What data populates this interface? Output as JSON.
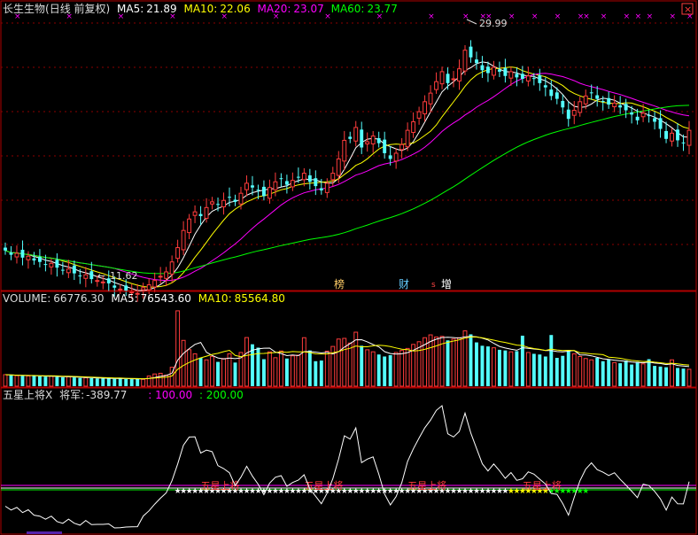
{
  "colors": {
    "bg": "#000000",
    "up": "#ff3c3c",
    "down": "#54ffff",
    "ma5": "#ffffff",
    "ma10": "#ffff00",
    "ma20": "#ff00ff",
    "ma60": "#00ff00",
    "grid": "#8b0000",
    "border": "#b00000",
    "label": "#dcdcdc",
    "general_line": "#ffffff",
    "level_100": "#ff00ff",
    "level_200": "#00ff00"
  },
  "header": {
    "stock": "长生生物",
    "period": "(日线 前复权)",
    "ma5_label": "MA5:",
    "ma5": "21.89",
    "ma10_label": "MA10:",
    "ma10": "22.06",
    "ma20_label": "MA20:",
    "ma20": "23.07",
    "ma60_label": "MA60:",
    "ma60": "23.77"
  },
  "volume_header": {
    "label": "VOLUME:",
    "value": "66776.30",
    "ma5_label": "MA5:",
    "ma5": "76543.60",
    "ma10_label": "MA10:",
    "ma10": "85564.80"
  },
  "indicator_header": {
    "name": "五星上将X",
    "general_label": "将军:",
    "general": "-389.77",
    "level1": ": 100.00",
    "level2": ": 200.00"
  },
  "annotations": {
    "high": "29.99",
    "low": "11.62",
    "marker_bang": "榜",
    "marker_cai": "财",
    "marker_zeng": "增",
    "marker_s": "s",
    "signal_text": "五星上将"
  },
  "chart_data": {
    "type": "candlestick",
    "price_axis": [
      12,
      32
    ],
    "close": [
      14.8,
      14.5,
      14.6,
      14.3,
      14.4,
      14.1,
      14.0,
      13.8,
      13.9,
      13.6,
      13.4,
      13.5,
      13.2,
      13.0,
      13.1,
      12.8,
      12.7,
      12.6,
      12.5,
      12.2,
      12.1,
      12.0,
      11.9,
      11.8,
      12.2,
      12.4,
      12.7,
      13.0,
      13.3,
      14.0,
      15.0,
      16.2,
      17.0,
      17.5,
      17.2,
      17.8,
      18.2,
      18.0,
      18.3,
      18.5,
      18.2,
      18.8,
      19.5,
      19.2,
      19.0,
      18.6,
      19.2,
      19.6,
      19.8,
      19.4,
      19.7,
      19.9,
      20.2,
      19.6,
      19.3,
      19.0,
      19.5,
      20.2,
      21.2,
      22.5,
      22.6,
      23.4,
      22.0,
      22.4,
      22.8,
      22.3,
      21.6,
      21.2,
      21.6,
      22.2,
      23.2,
      23.8,
      24.5,
      25.2,
      25.8,
      26.6,
      27.3,
      26.5,
      26.8,
      27.5,
      28.8,
      28.3,
      27.9,
      27.4,
      27.2,
      27.6,
      27.3,
      27.0,
      27.3,
      26.9,
      26.8,
      27.0,
      26.8,
      26.5,
      26.2,
      25.6,
      25.4,
      24.8,
      24.0,
      24.6,
      25.2,
      25.6,
      25.8,
      25.4,
      25.2,
      25.0,
      25.1,
      24.8,
      24.6,
      24.3,
      23.9,
      24.4,
      24.2,
      23.8,
      23.3,
      22.6,
      23.0,
      22.5,
      22.3,
      23.2
    ],
    "volume": [
      8600,
      8100,
      7900,
      7700,
      7600,
      7900,
      7300,
      7100,
      7500,
      6900,
      6600,
      7100,
      6500,
      6100,
      6300,
      6000,
      5700,
      5800,
      5600,
      5500,
      5900,
      5400,
      5200,
      5300,
      5100,
      7600,
      9100,
      9600,
      8200,
      14100,
      56100,
      34100,
      27200,
      24100,
      21200,
      19600,
      22200,
      18100,
      20600,
      24100,
      17600,
      25100,
      36200,
      31200,
      28700,
      20100,
      25600,
      21200,
      26200,
      20600,
      22600,
      23100,
      36100,
      26600,
      18600,
      19100,
      26100,
      29600,
      35100,
      35600,
      32100,
      40200,
      30100,
      27100,
      25600,
      23600,
      22100,
      23100,
      25100,
      26600,
      28100,
      31100,
      33100,
      36100,
      38200,
      36600,
      37100,
      34100,
      35100,
      36100,
      41200,
      38600,
      32600,
      30100,
      29600,
      28600,
      27100,
      26600,
      25600,
      26100,
      37600,
      25100,
      24100,
      23600,
      22100,
      38100,
      21100,
      22600,
      26600,
      24100,
      22100,
      20600,
      19600,
      21100,
      18600,
      20100,
      17600,
      17100,
      19100,
      16100,
      18100,
      16600,
      20100,
      15100,
      14600,
      14100,
      19600,
      13600,
      13100,
      12600
    ],
    "ma": {
      "ma5": "21.89",
      "ma10": "22.06",
      "ma20": "23.07",
      "ma60": "23.77"
    },
    "annotations": [
      {
        "text": "29.99",
        "type": "high"
      },
      {
        "text": "11.62",
        "type": "low"
      }
    ],
    "general_indicator_current": -389.77,
    "indicator_levels": [
      100.0,
      200.0
    ]
  }
}
